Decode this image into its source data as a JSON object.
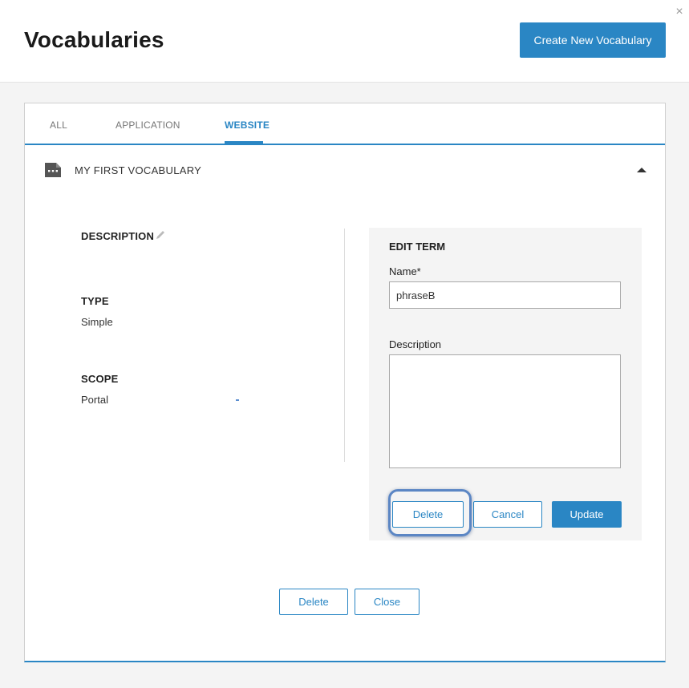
{
  "header": {
    "title": "Vocabularies",
    "create_button": "Create New Vocabulary",
    "close_icon": "×"
  },
  "tabs": [
    {
      "label": "ALL",
      "active": false
    },
    {
      "label": "APPLICATION",
      "active": false
    },
    {
      "label": "WEBSITE",
      "active": true
    }
  ],
  "vocabulary": {
    "name": "MY FIRST VOCABULARY",
    "icon": "vocabulary-icon",
    "expanded": true
  },
  "details": {
    "description_label": "DESCRIPTION",
    "type_label": "TYPE",
    "type_value": "Simple",
    "scope_label": "SCOPE",
    "scope_value": "Portal"
  },
  "edit_term": {
    "title": "EDIT TERM",
    "name_label": "Name*",
    "name_value": "phraseB",
    "description_label": "Description",
    "description_value": "",
    "delete_label": "Delete",
    "cancel_label": "Cancel",
    "update_label": "Update"
  },
  "footer": {
    "delete_label": "Delete",
    "close_label": "Close"
  },
  "colors": {
    "accent": "#2a86c4",
    "focus_ring": "#5b86c4"
  }
}
